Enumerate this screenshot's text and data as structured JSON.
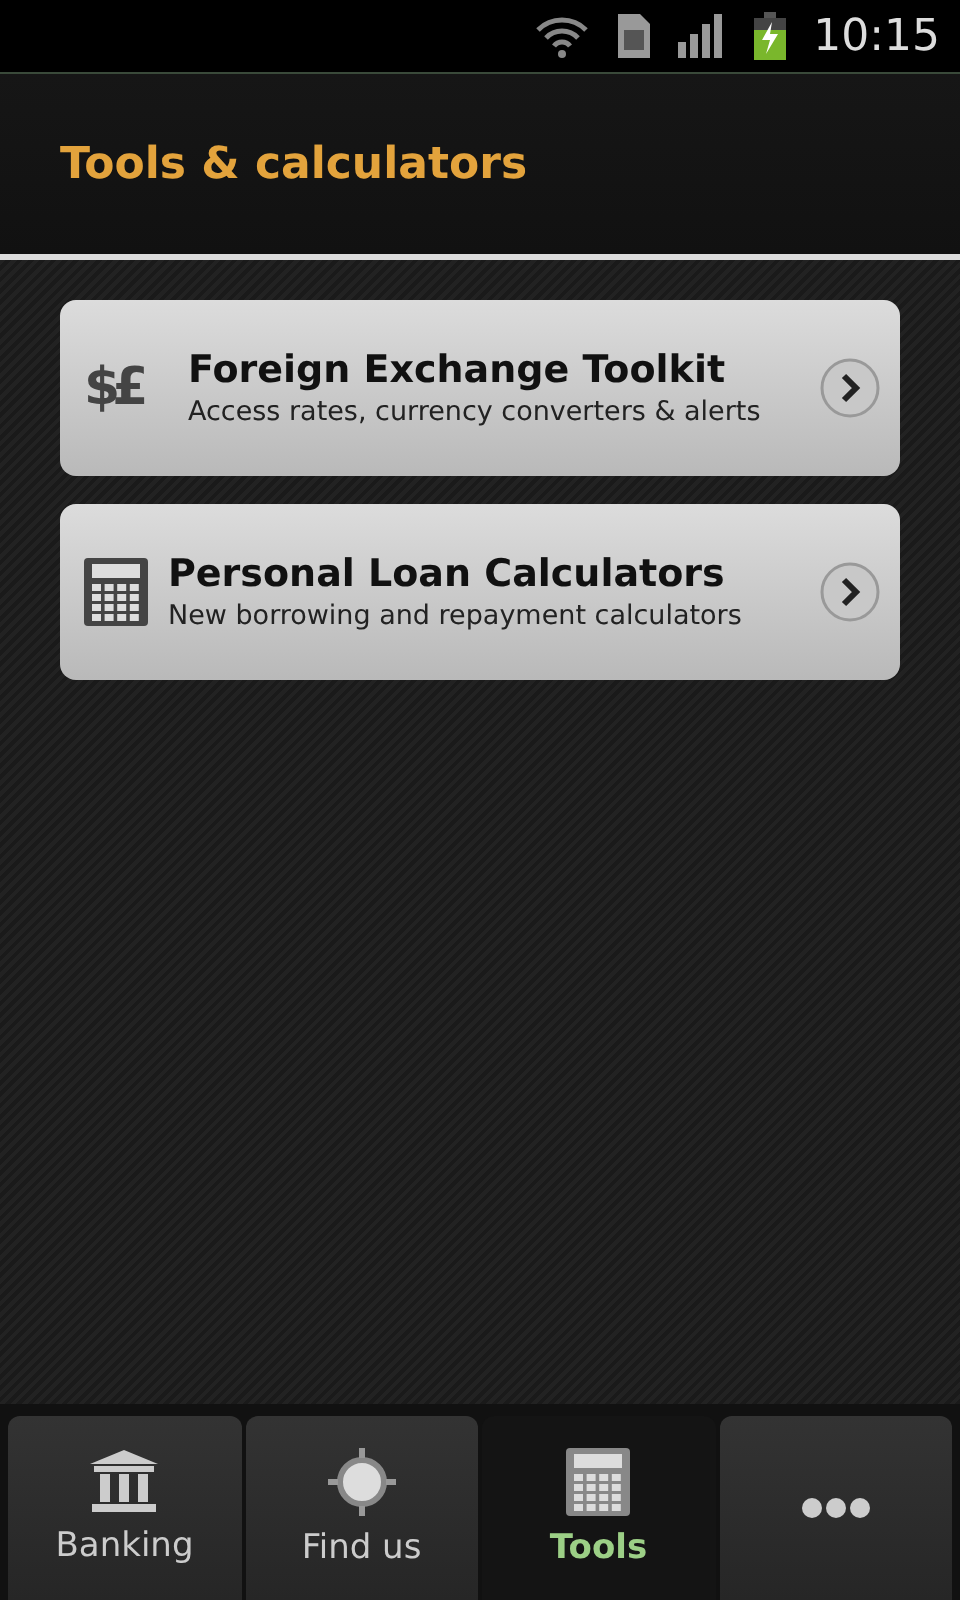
{
  "status_bar": {
    "time": "10:15"
  },
  "header": {
    "title": "Tools & calculators"
  },
  "items": [
    {
      "kind": "currency",
      "glyphs": "$£",
      "title": "Foreign Exchange Toolkit",
      "subtitle": "Access rates, currency converters & alerts"
    },
    {
      "kind": "calculator",
      "title": "Personal Loan Calculators",
      "subtitle": "New borrowing and repayment calculators"
    }
  ],
  "tabs": [
    {
      "kind": "bank",
      "label": "Banking",
      "selected": false
    },
    {
      "kind": "target",
      "label": "Find us",
      "selected": false
    },
    {
      "kind": "calculator",
      "label": "Tools",
      "selected": true
    },
    {
      "kind": "more",
      "selected": false
    }
  ]
}
